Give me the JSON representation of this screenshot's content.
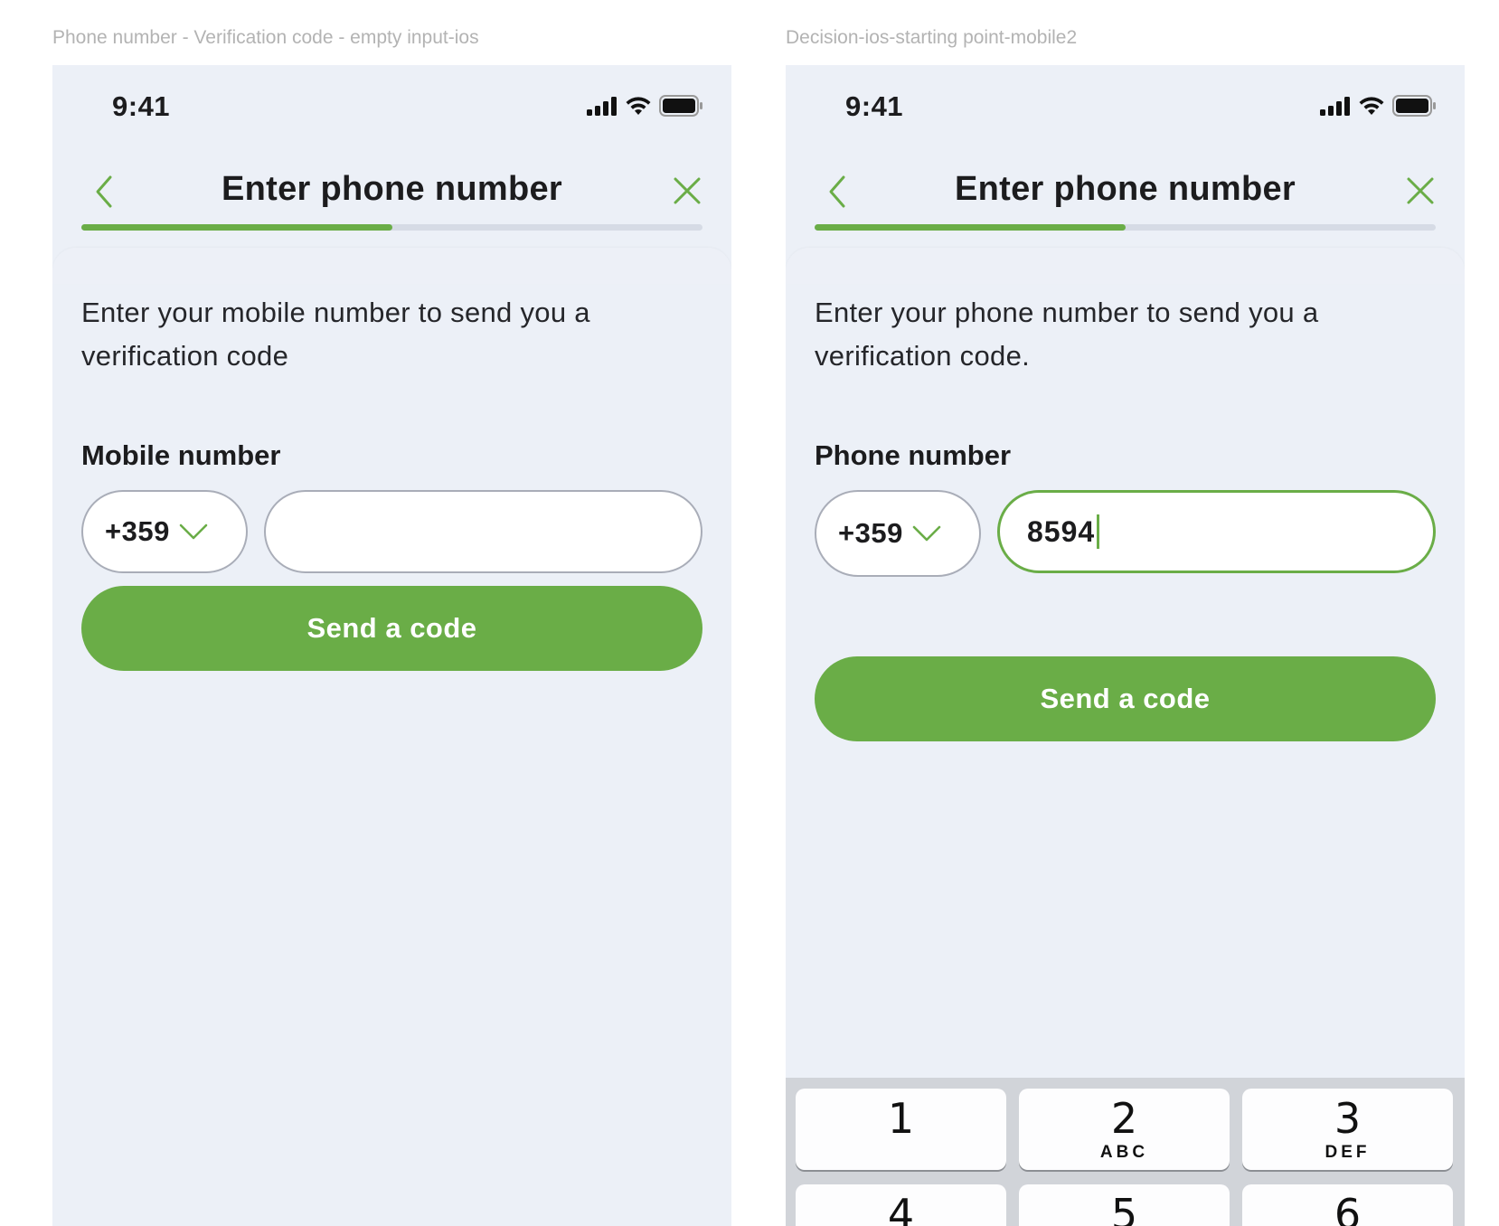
{
  "frames": [
    {
      "caption": "Phone number - Verification code - empty input-ios",
      "status_time": "9:41",
      "title": "Enter phone number",
      "progress_fraction": 0.5,
      "description": "Enter your mobile number to send you a verification code",
      "field_label": "Mobile number",
      "country_code": "+359",
      "phone_value": "",
      "button_label": "Send a code"
    },
    {
      "caption": "Decision-ios-starting point-mobile2",
      "status_time": "9:41",
      "title": "Enter phone number",
      "progress_fraction": 0.5,
      "description": "Enter your phone number to send you a verification code.",
      "field_label": "Phone number",
      "country_code": "+359",
      "phone_value": "8594",
      "button_label": "Send a code",
      "keypad": [
        {
          "digit": "1",
          "letters": ""
        },
        {
          "digit": "2",
          "letters": "ABC"
        },
        {
          "digit": "3",
          "letters": "DEF"
        },
        {
          "digit": "4",
          "letters": ""
        },
        {
          "digit": "5",
          "letters": ""
        },
        {
          "digit": "6",
          "letters": ""
        }
      ]
    }
  ],
  "colors": {
    "accent": "#6aad47",
    "screen_bg": "#ecf0f7",
    "track": "#d6dbe5",
    "keyboard_bg": "#d1d4d9"
  },
  "icons": [
    "signal-icon",
    "wifi-icon",
    "battery-icon",
    "back-chevron-icon",
    "close-icon",
    "chevron-down-icon"
  ]
}
